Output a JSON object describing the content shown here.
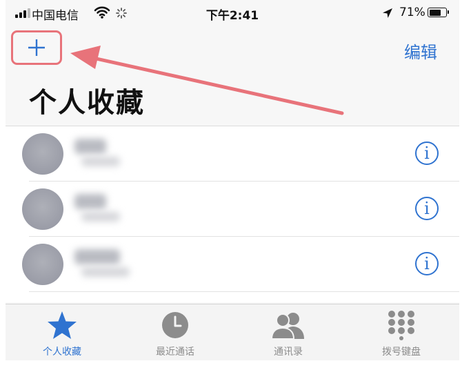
{
  "status_bar": {
    "carrier": "中国电信",
    "time": "下午2:41",
    "battery_percent": "71%",
    "battery_level": 0.71,
    "icons": [
      "signal-icon",
      "wifi-icon",
      "activity-spinner-icon",
      "location-arrow-icon",
      "battery-icon"
    ]
  },
  "nav": {
    "add_label": "+",
    "edit_label": "编辑",
    "title": "个人收藏"
  },
  "annotation": {
    "color": "#e8737a",
    "type": "arrow pointing to add button"
  },
  "favorites": [
    {
      "name": "",
      "subtitle": "",
      "info_label": "i"
    },
    {
      "name": "",
      "subtitle": "",
      "info_label": "i"
    },
    {
      "name": "",
      "subtitle": "",
      "info_label": "i"
    }
  ],
  "tab_bar": {
    "tabs": [
      {
        "label": "个人收藏",
        "icon": "star-icon",
        "active": true
      },
      {
        "label": "最近通话",
        "icon": "clock-icon",
        "active": false
      },
      {
        "label": "通讯录",
        "icon": "contacts-icon",
        "active": false
      },
      {
        "label": "拨号键盘",
        "icon": "keypad-icon",
        "active": false
      }
    ]
  },
  "colors": {
    "accent": "#2f73d0",
    "annotation": "#e8737a",
    "inactive_tab": "#8c8c8c"
  }
}
